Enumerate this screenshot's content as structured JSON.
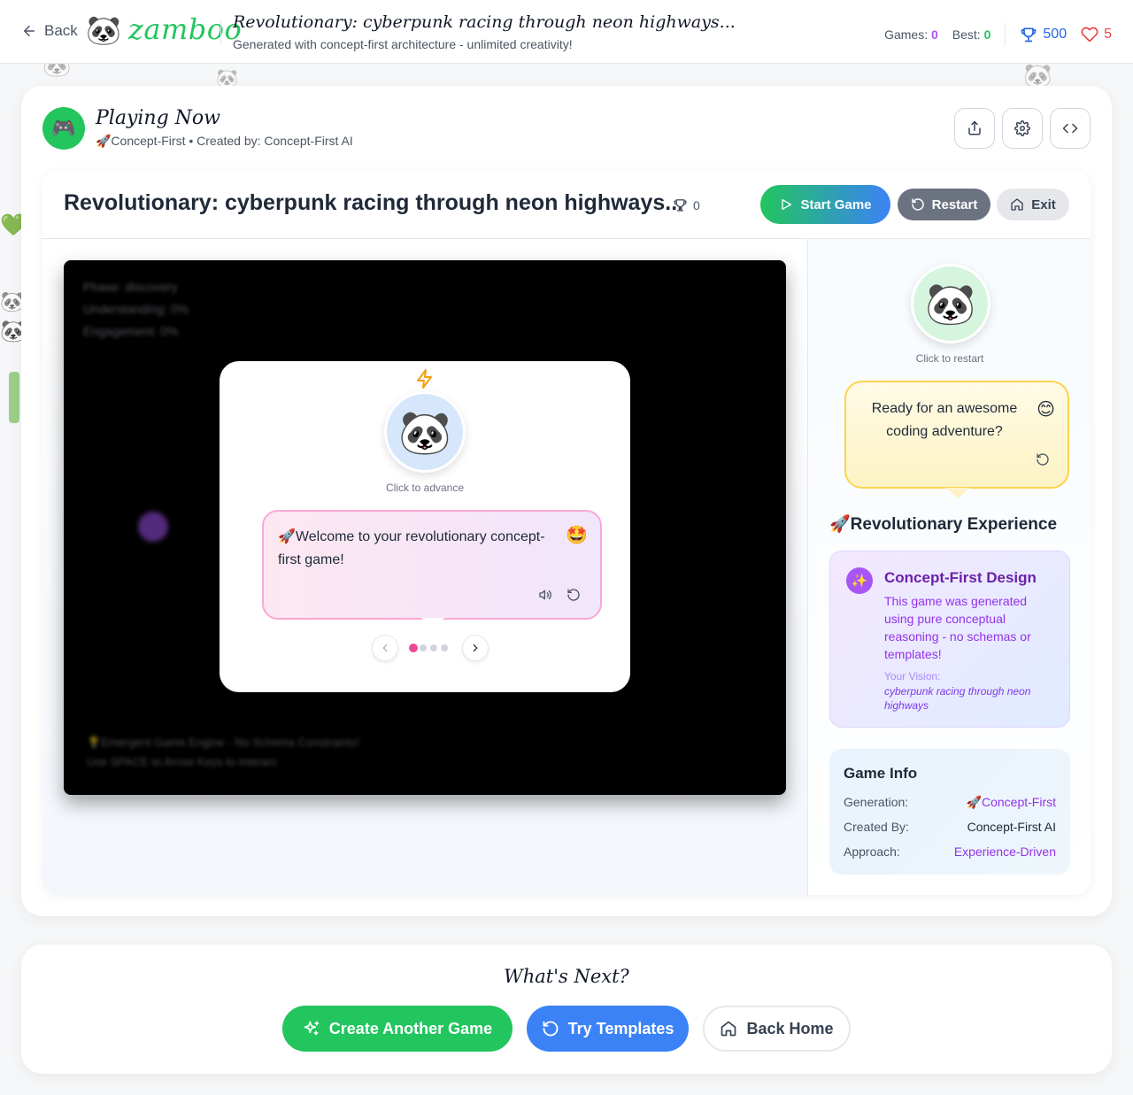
{
  "topbar": {
    "back_label": "Back",
    "logo_text": "zamboo",
    "title": "Revolutionary: cyberpunk racing through neon highways...",
    "subtitle": "Generated with concept-first architecture - unlimited creativity!",
    "games_label": "Games:",
    "games_value": "0",
    "best_label": "Best:",
    "best_value": "0",
    "trophies": "500",
    "lives": "5"
  },
  "playing": {
    "title": "Playing Now",
    "subtitle": "🚀Concept-First • Created by: Concept-First AI"
  },
  "game": {
    "title": "Revolutionary: cyberpunk racing through neon highways...",
    "score": "0",
    "start_label": "Start Game",
    "restart_label": "Restart",
    "exit_label": "Exit",
    "hud": [
      "Phase: discovery",
      "Understanding: 0%",
      "Engagement: 0%"
    ],
    "footer": [
      "💡Emergent Game Engine - No Schema Constraints!",
      "Use SPACE to Arrow Keys to interact"
    ]
  },
  "dialog": {
    "hint": "Click to advance",
    "message": "🚀Welcome to your revolutionary concept-first game!",
    "emoji": "🤩",
    "pages_total": 4,
    "page_active": 1
  },
  "sidebar": {
    "hint": "Click to restart",
    "message": "Ready for an awesome coding adventure?",
    "emoji": "😊",
    "section_title": "🚀Revolutionary Experience",
    "concept": {
      "title": "Concept-First Design",
      "icon": "✨",
      "text": "This game was generated using pure conceptual reasoning - no schemas or templates!",
      "vision_label": "Your Vision:",
      "vision": "cyberpunk racing through neon highways"
    },
    "info": {
      "title": "Game Info",
      "rows": [
        {
          "label": "Generation:",
          "value": "🚀Concept-First"
        },
        {
          "label": "Created By:",
          "value": "Concept-First AI"
        },
        {
          "label": "Approach:",
          "value": "Experience-Driven"
        }
      ]
    }
  },
  "next": {
    "title": "What's Next?",
    "create_label": "Create Another Game",
    "templates_label": "Try Templates",
    "home_label": "Back Home"
  },
  "colors": {
    "brand_green": "#22c55e",
    "accent_blue": "#3b82f6",
    "accent_purple": "#a855f7",
    "lives_red": "#ef4444"
  }
}
